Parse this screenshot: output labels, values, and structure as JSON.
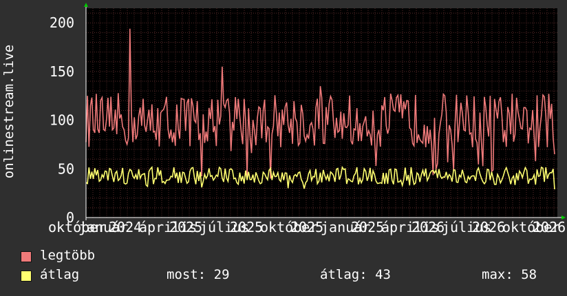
{
  "chart_data": {
    "type": "line",
    "ylabel": "onlinestream.live",
    "ylim": [
      0,
      215
    ],
    "y_ticks": [
      0,
      50,
      100,
      150,
      200
    ],
    "x_tick_labels": [
      "október",
      "január",
      "2024",
      "április",
      "2025",
      "július",
      "2025",
      "október",
      "2025",
      "január",
      "2025",
      "április",
      "2026",
      "július",
      "2026",
      "október",
      "2026"
    ],
    "grid": true,
    "colors": {
      "background": "#2f2f2f",
      "plot": "#000000",
      "grid": "#5a2a2a",
      "axis": "#ffffff",
      "arrow": "#00cc00"
    },
    "series": [
      {
        "name": "legtöbb",
        "color": "#f07a7a",
        "mean": 100,
        "amplitude": 28,
        "spikes": [
          [
            0.095,
            194
          ],
          [
            0.29,
            155
          ],
          [
            0.5,
            135
          ],
          [
            0.8,
            118
          ]
        ]
      },
      {
        "name": "átlag",
        "color": "#ffff70",
        "mean": 43,
        "amplitude": 9,
        "spikes": []
      }
    ]
  },
  "legend": {
    "items": [
      {
        "label": "legtöbb",
        "color": "#f07a7a"
      },
      {
        "label": "átlag",
        "color": "#ffff70"
      }
    ],
    "stats": {
      "now": "most: 29",
      "avg": "átlag: 43",
      "max": "max: 58"
    }
  }
}
